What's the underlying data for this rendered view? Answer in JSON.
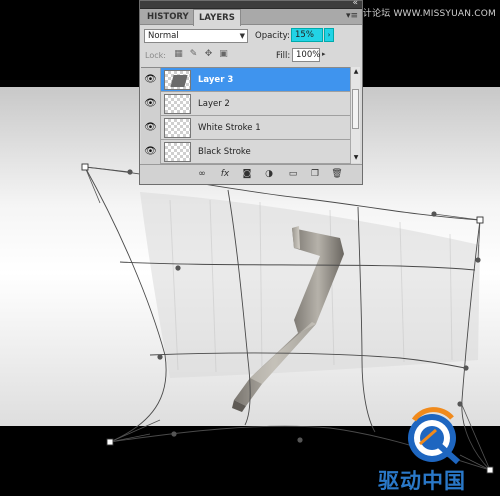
{
  "watermark": "思缘设计论坛 WWW.MISSYUAN.COM",
  "panel": {
    "collapse_glyph": "«",
    "tabs": [
      {
        "label": "HISTORY",
        "active": false
      },
      {
        "label": "LAYERS",
        "active": true
      }
    ],
    "menu_icon": "panel-menu-icon",
    "blend_mode": "Normal",
    "opacity_label": "Opacity:",
    "opacity_value": "15%",
    "lock_label": "Lock:",
    "fill_label": "Fill:",
    "fill_value": "100%",
    "layers": [
      {
        "name": "Layer 3",
        "selected": true,
        "has_shape": true
      },
      {
        "name": "Layer 2",
        "selected": false,
        "has_shape": false
      },
      {
        "name": "White Stroke 1",
        "selected": false,
        "has_shape": false
      },
      {
        "name": "Black Stroke",
        "selected": false,
        "has_shape": false
      }
    ],
    "footer_icons": [
      "link-icon",
      "fx-icon",
      "mask-icon",
      "adjustment-icon",
      "folder-icon",
      "new-layer-icon",
      "trash-icon"
    ]
  },
  "logo": {
    "text": "驱动中国",
    "letter": "Q"
  },
  "colors": {
    "selection": "#3f94ee",
    "opacity_highlight": "#22d3e6",
    "logo_blue": "#2a78c8",
    "logo_orange": "#f08a1c"
  }
}
